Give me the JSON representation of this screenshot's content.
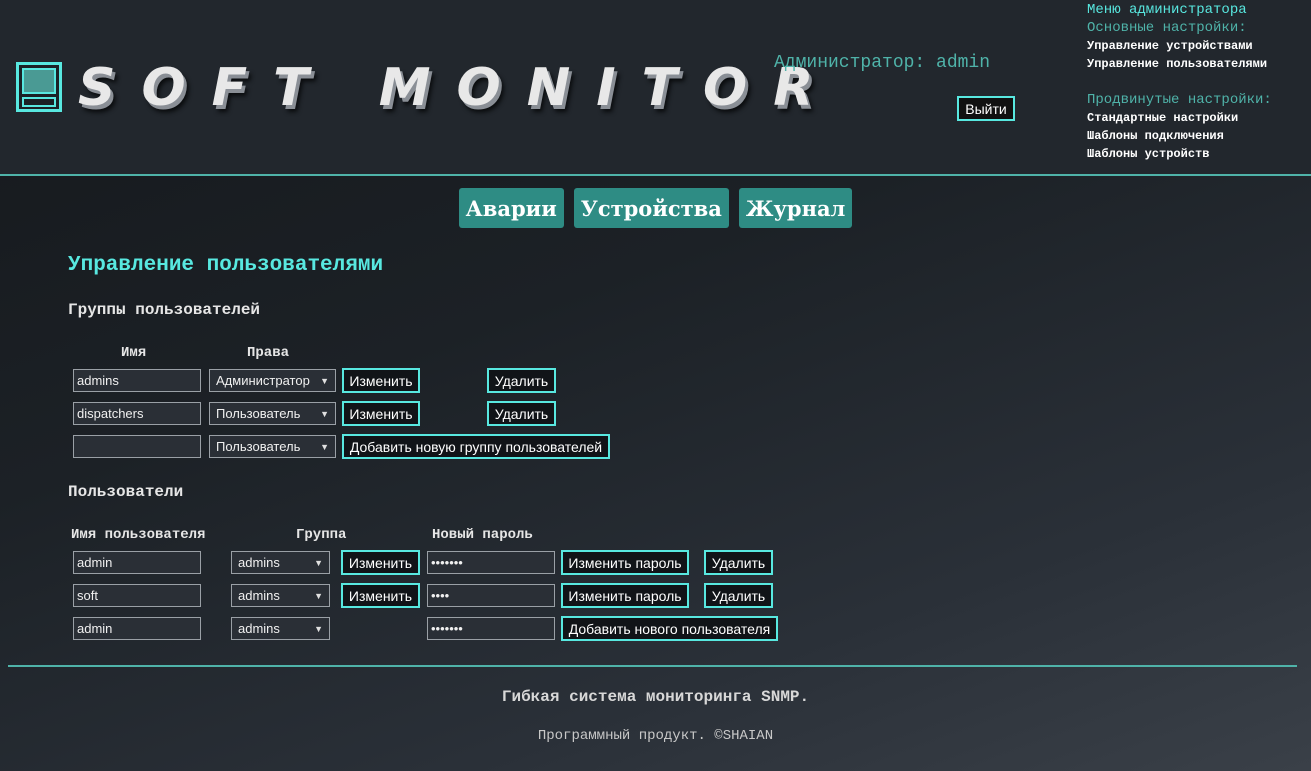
{
  "header": {
    "logo_text": "SOFT MONITOR",
    "admin_label": "Администратор: admin",
    "logout_label": "Выйти"
  },
  "admin_menu": {
    "title": "Меню администратора",
    "basic_section": "Основные настройки:",
    "basic_items": [
      "Управление устройствами",
      "Управление пользователями"
    ],
    "advanced_section": "Продвинутые настройки:",
    "advanced_items": [
      "Стандартные настройки",
      "Шаблоны подключения",
      "Шаблоны устройств"
    ]
  },
  "nav": {
    "tabs": [
      "Аварии",
      "Устройства",
      "Журнал"
    ]
  },
  "page_title": "Управление пользователями",
  "groups": {
    "title": "Группы пользователей",
    "col_name": "Имя",
    "col_rights": "Права",
    "rows": [
      {
        "name": "admins",
        "rights": "Администратор",
        "edit": "Изменить",
        "delete": "Удалить"
      },
      {
        "name": "dispatchers",
        "rights": "Пользователь",
        "edit": "Изменить",
        "delete": "Удалить"
      }
    ],
    "new_row": {
      "name": "",
      "rights": "Пользователь",
      "add": "Добавить новую группу пользователей"
    }
  },
  "users": {
    "title": "Пользователи",
    "col_username": "Имя пользователя",
    "col_group": "Группа",
    "col_password": "Новый пароль",
    "rows": [
      {
        "username": "admin",
        "group": "admins",
        "edit": "Изменить",
        "password": "•••••••",
        "change_password": "Изменить пароль",
        "delete": "Удалить"
      },
      {
        "username": "soft",
        "group": "admins",
        "edit": "Изменить",
        "password": "••••",
        "change_password": "Изменить пароль",
        "delete": "Удалить"
      }
    ],
    "new_row": {
      "username": "admin",
      "group": "admins",
      "password": "•••••••",
      "add": "Добавить нового пользователя"
    }
  },
  "footer": {
    "line1": "Гибкая система мониторинга SNMP.",
    "line2": "Программный продукт. ©SHAIAN"
  },
  "colors": {
    "accent": "#58e8e0",
    "teal": "#4fb3a9",
    "nav_bg": "#2e8c84"
  }
}
